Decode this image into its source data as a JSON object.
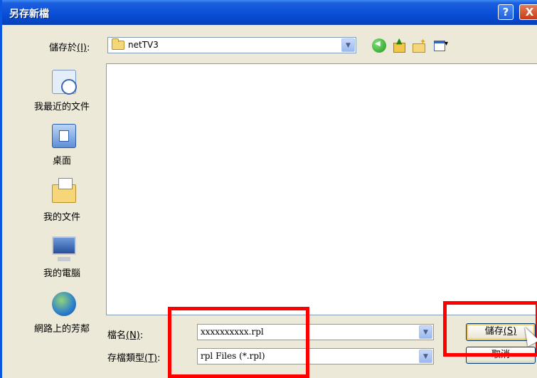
{
  "window": {
    "title": "另存新檔",
    "help_label": "?",
    "close_label": "X"
  },
  "toolbar": {
    "save_in_label_prefix": "儲存於",
    "save_in_accel": "(I)",
    "save_in_suffix": ":",
    "current_folder": "netTV3",
    "icons": [
      "back-icon",
      "up-folder-icon",
      "new-folder-icon",
      "view-menu-icon"
    ]
  },
  "places": [
    {
      "label": "我最近的文件",
      "icon": "recent-documents-icon"
    },
    {
      "label": "桌面",
      "icon": "desktop-icon"
    },
    {
      "label": "我的文件",
      "icon": "my-documents-icon"
    },
    {
      "label": "我的電腦",
      "icon": "my-computer-icon"
    },
    {
      "label": "網路上的芳鄰",
      "icon": "network-places-icon"
    }
  ],
  "form": {
    "filename_label": "檔名",
    "filename_accel": "(N)",
    "filename_suffix": ":",
    "filename_value": "xxxxxxxxxx.rpl",
    "filetype_label": "存檔類型",
    "filetype_accel": "(T)",
    "filetype_suffix": ":",
    "filetype_value": "rpl Files (*.rpl)"
  },
  "buttons": {
    "save_label": "儲存",
    "save_accel": "(S)",
    "cancel_label": "取消"
  },
  "dropdown_glyph": "▼",
  "colors": {
    "titlebar": "#0a4fd6",
    "highlight_box": "#ff0000",
    "dialog_bg": "#ece9d8"
  }
}
